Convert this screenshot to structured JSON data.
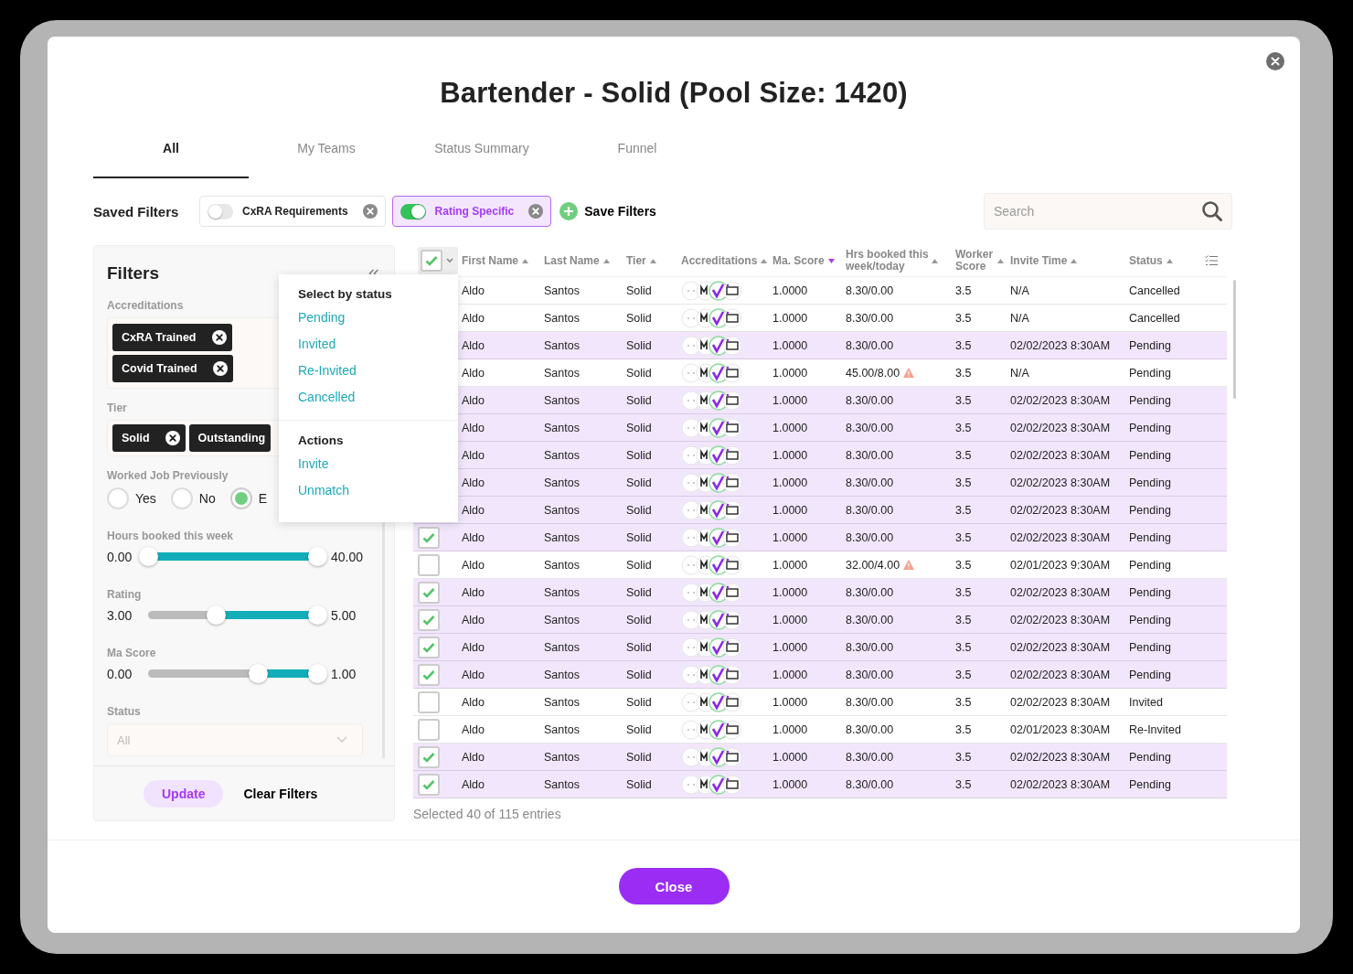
{
  "dialog": {
    "title": "Bartender - Solid (Pool Size: 1420)"
  },
  "tabs": [
    {
      "label": "All",
      "selected": true
    },
    {
      "label": "My Teams",
      "selected": false
    },
    {
      "label": "Status Summary",
      "selected": false
    },
    {
      "label": "Funnel",
      "selected": false
    }
  ],
  "saved_filters": {
    "label": "Saved Filters",
    "items": [
      {
        "label": "CxRA Requirements",
        "on": false
      },
      {
        "label": "Rating Specific",
        "on": true
      }
    ],
    "save_label": "Save Filters"
  },
  "search": {
    "placeholder": "Search"
  },
  "filters": {
    "title": "Filters",
    "accreditations": {
      "label": "Accreditations",
      "chips": [
        "CxRA Trained",
        "Covid Trained"
      ]
    },
    "tier": {
      "label": "Tier",
      "chips": [
        "Solid",
        "Outstanding"
      ]
    },
    "worked_job": {
      "label": "Worked Job Previously",
      "options": [
        {
          "label": "Yes",
          "selected": false
        },
        {
          "label": "No",
          "selected": false
        },
        {
          "label": "E",
          "selected": true
        }
      ]
    },
    "sliders": [
      {
        "label": "Hours booked this week",
        "min": "0.00",
        "max": "40.00",
        "thumbs": [
          {
            "level": 0
          },
          {
            "level": 1
          }
        ]
      },
      {
        "label": "Rating",
        "min": "3.00",
        "max": "5.00",
        "thumbs": [
          {
            "level": 0.4
          },
          {
            "level": 1
          }
        ]
      },
      {
        "label": "Ma Score",
        "min": "0.00",
        "max": "1.00",
        "thumbs": [
          {
            "level": 0.65
          },
          {
            "level": 1
          }
        ]
      }
    ],
    "status": {
      "label": "Status",
      "placeholder": "All"
    },
    "update_label": "Update",
    "clear_label": "Clear Filters"
  },
  "select_menu": {
    "heading": "Select by status",
    "statuses": [
      "Pending",
      "Invited",
      "Re-Invited",
      "Cancelled"
    ],
    "actions_heading": "Actions",
    "actions": [
      "Invite",
      "Unmatch"
    ]
  },
  "table": {
    "select_all_checked": true,
    "columns": [
      {
        "label": "First Name",
        "sorted": false
      },
      {
        "label": "Last Name",
        "sorted": false
      },
      {
        "label": "Tier",
        "sorted": false
      },
      {
        "label": "Accreditations",
        "sorted": false
      },
      {
        "label": "Ma. Score",
        "sorted": true
      },
      {
        "label": "Hrs booked this week/today",
        "sorted": false
      },
      {
        "label": "Worker Score",
        "sorted": false
      },
      {
        "label": "Invite Time",
        "sorted": false
      },
      {
        "label": "Status",
        "sorted": false
      }
    ],
    "rows": [
      {
        "selected": false,
        "first": "Aldo",
        "last": "Santos",
        "tier": "Solid",
        "ma": "1.0000",
        "hrs": "8.30/0.00",
        "warn": false,
        "score": "3.5",
        "invite": "N/A",
        "status": "Cancelled"
      },
      {
        "selected": false,
        "first": "Aldo",
        "last": "Santos",
        "tier": "Solid",
        "ma": "1.0000",
        "hrs": "8.30/0.00",
        "warn": false,
        "score": "3.5",
        "invite": "N/A",
        "status": "Cancelled"
      },
      {
        "selected": true,
        "first": "Aldo",
        "last": "Santos",
        "tier": "Solid",
        "ma": "1.0000",
        "hrs": "8.30/0.00",
        "warn": false,
        "score": "3.5",
        "invite": "02/02/2023 8:30AM",
        "status": "Pending"
      },
      {
        "selected": false,
        "first": "Aldo",
        "last": "Santos",
        "tier": "Solid",
        "ma": "1.0000",
        "hrs": "45.00/8.00",
        "warn": true,
        "score": "3.5",
        "invite": "N/A",
        "status": "Pending"
      },
      {
        "selected": true,
        "first": "Aldo",
        "last": "Santos",
        "tier": "Solid",
        "ma": "1.0000",
        "hrs": "8.30/0.00",
        "warn": false,
        "score": "3.5",
        "invite": "02/02/2023 8:30AM",
        "status": "Pending"
      },
      {
        "selected": true,
        "first": "Aldo",
        "last": "Santos",
        "tier": "Solid",
        "ma": "1.0000",
        "hrs": "8.30/0.00",
        "warn": false,
        "score": "3.5",
        "invite": "02/02/2023 8:30AM",
        "status": "Pending"
      },
      {
        "selected": true,
        "first": "Aldo",
        "last": "Santos",
        "tier": "Solid",
        "ma": "1.0000",
        "hrs": "8.30/0.00",
        "warn": false,
        "score": "3.5",
        "invite": "02/02/2023 8:30AM",
        "status": "Pending"
      },
      {
        "selected": true,
        "first": "Aldo",
        "last": "Santos",
        "tier": "Solid",
        "ma": "1.0000",
        "hrs": "8.30/0.00",
        "warn": false,
        "score": "3.5",
        "invite": "02/02/2023 8:30AM",
        "status": "Pending"
      },
      {
        "selected": true,
        "first": "Aldo",
        "last": "Santos",
        "tier": "Solid",
        "ma": "1.0000",
        "hrs": "8.30/0.00",
        "warn": false,
        "score": "3.5",
        "invite": "02/02/2023 8:30AM",
        "status": "Pending"
      },
      {
        "selected": true,
        "first": "Aldo",
        "last": "Santos",
        "tier": "Solid",
        "ma": "1.0000",
        "hrs": "8.30/0.00",
        "warn": false,
        "score": "3.5",
        "invite": "02/02/2023 8:30AM",
        "status": "Pending"
      },
      {
        "selected": false,
        "first": "Aldo",
        "last": "Santos",
        "tier": "Solid",
        "ma": "1.0000",
        "hrs": "32.00/4.00",
        "warn": true,
        "score": "3.5",
        "invite": "02/01/2023 9:30AM",
        "status": "Pending"
      },
      {
        "selected": true,
        "first": "Aldo",
        "last": "Santos",
        "tier": "Solid",
        "ma": "1.0000",
        "hrs": "8.30/0.00",
        "warn": false,
        "score": "3.5",
        "invite": "02/02/2023 8:30AM",
        "status": "Pending"
      },
      {
        "selected": true,
        "first": "Aldo",
        "last": "Santos",
        "tier": "Solid",
        "ma": "1.0000",
        "hrs": "8.30/0.00",
        "warn": false,
        "score": "3.5",
        "invite": "02/02/2023 8:30AM",
        "status": "Pending"
      },
      {
        "selected": true,
        "first": "Aldo",
        "last": "Santos",
        "tier": "Solid",
        "ma": "1.0000",
        "hrs": "8.30/0.00",
        "warn": false,
        "score": "3.5",
        "invite": "02/02/2023 8:30AM",
        "status": "Pending"
      },
      {
        "selected": true,
        "first": "Aldo",
        "last": "Santos",
        "tier": "Solid",
        "ma": "1.0000",
        "hrs": "8.30/0.00",
        "warn": false,
        "score": "3.5",
        "invite": "02/02/2023 8:30AM",
        "status": "Pending"
      },
      {
        "selected": false,
        "first": "Aldo",
        "last": "Santos",
        "tier": "Solid",
        "ma": "1.0000",
        "hrs": "8.30/0.00",
        "warn": false,
        "score": "3.5",
        "invite": "02/02/2023 8:30AM",
        "status": "Invited"
      },
      {
        "selected": false,
        "first": "Aldo",
        "last": "Santos",
        "tier": "Solid",
        "ma": "1.0000",
        "hrs": "8.30/0.00",
        "warn": false,
        "score": "3.5",
        "invite": "02/01/2023 8:30AM",
        "status": "Re-Invited"
      },
      {
        "selected": true,
        "first": "Aldo",
        "last": "Santos",
        "tier": "Solid",
        "ma": "1.0000",
        "hrs": "8.30/0.00",
        "warn": false,
        "score": "3.5",
        "invite": "02/02/2023 8:30AM",
        "status": "Pending"
      },
      {
        "selected": true,
        "first": "Aldo",
        "last": "Santos",
        "tier": "Solid",
        "ma": "1.0000",
        "hrs": "8.30/0.00",
        "warn": false,
        "score": "3.5",
        "invite": "02/02/2023 8:30AM",
        "status": "Pending"
      }
    ],
    "summary": "Selected 40 of 115 entries"
  },
  "footer": {
    "close_label": "Close"
  }
}
